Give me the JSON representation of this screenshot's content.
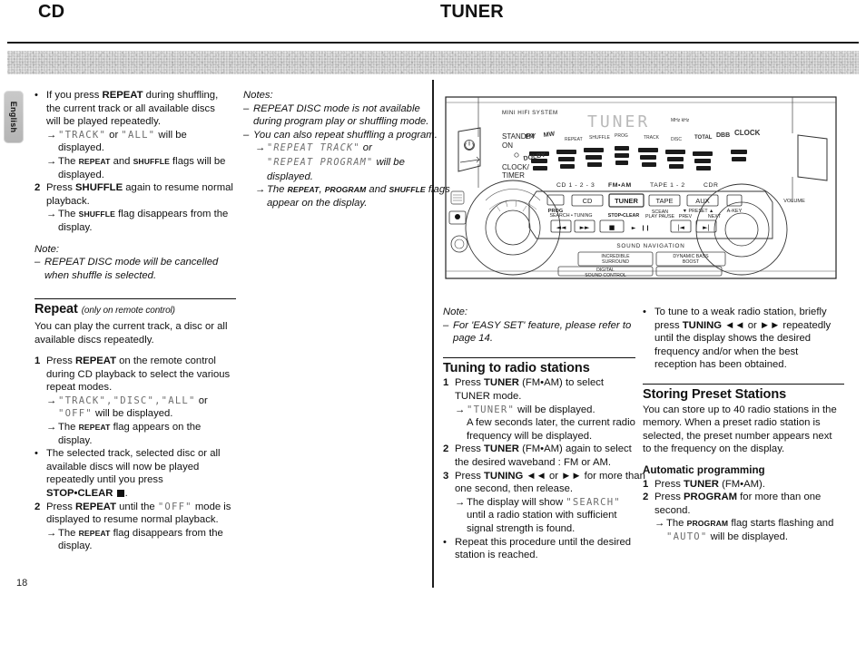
{
  "page": {
    "number": "18",
    "language_tab": "English"
  },
  "headers": {
    "left": "CD",
    "right": "TUNER"
  },
  "cd_column_1": {
    "bullet_repeat": {
      "marker": "•",
      "lines": [
        "If you press REPEAT during shuffling,",
        "the current track or all available discs",
        "will be played repeatedly."
      ],
      "bold_words": [
        "REPEAT"
      ]
    },
    "arrow_1": {
      "marker": "→",
      "lcd_a": "\"TRACK\"",
      "mid": " or ",
      "lcd_b": "\"ALL\"",
      "tail": " will be",
      "line2": "displayed."
    },
    "arrow_2": {
      "marker": "→",
      "pre": "The ",
      "sc_a": "REPEAT",
      "mid": " and ",
      "sc_b": "SHUFFLE",
      "tail": " flags will be",
      "line2": "displayed."
    },
    "step_2": {
      "marker": "2",
      "pre": "Press ",
      "bold": "SHUFFLE",
      "tail": " again to resume normal",
      "line2": "playback."
    },
    "arrow_3": {
      "marker": "→",
      "pre": "The ",
      "sc": "SHUFFLE",
      "tail": " flag disappears from the",
      "line2": "display."
    },
    "note_head": "Note:",
    "note_item": {
      "marker": "–",
      "line1": "REPEAT DISC mode will be cancelled",
      "line2": "when shuffle is selected."
    },
    "repeat_section": {
      "heading": "Repeat",
      "heading_note": "(only on remote control)",
      "intro_l1": "You can play the current track, a disc or all",
      "intro_l2": "available discs repeatedly."
    },
    "step_r1": {
      "marker": "1",
      "pre": "Press ",
      "bold": "REPEAT",
      "tail": " on the remote control",
      "line2": "during CD playback to select the various",
      "line3": "repeat modes."
    },
    "arrow_r1": {
      "marker": "→",
      "lcd_a": "\"TRACK\",",
      "lcd_b": "\"DISC\",",
      "lcd_c": "\"ALL\"",
      "tail": " or",
      "lcd_d": "\"OFF\"",
      "tail2": " will be displayed."
    },
    "arrow_r2": {
      "marker": "→",
      "pre": "The ",
      "sc": "REPEAT",
      "tail": " flag appears on the",
      "line2": "display."
    },
    "bullet_r1": {
      "marker": "•",
      "line1": "The selected track, selected disc or all",
      "line2": "available discs will now be played",
      "line3": "repeatedly until you press",
      "line4_bold": "STOP•CLEAR"
    },
    "step_r2": {
      "marker": "2",
      "pre": "Press ",
      "bold": "REPEAT",
      "mid": " until the ",
      "lcd": "\"OFF\"",
      "tail": " mode is",
      "line2": "displayed to resume normal playback."
    },
    "arrow_r3": {
      "marker": "→",
      "pre": "The ",
      "sc": "REPEAT",
      "tail": " flag disappears from the",
      "line2": "display."
    }
  },
  "cd_column_2": {
    "notes_head": "Notes:",
    "note_1": {
      "marker": "–",
      "line1": "REPEAT DISC mode is not available",
      "line2": "during program play or shuffling mode."
    },
    "note_2": {
      "marker": "–",
      "line1": "You can also repeat shuffling a program."
    },
    "arrow_n1": {
      "marker": "→",
      "lcd_a": "\"REPEAT TRACK\"",
      "tail_a": " or",
      "lcd_b": "\"REPEAT PROGRAM\"",
      "tail_b": " will be",
      "line3": "displayed."
    },
    "arrow_n2": {
      "marker": "→",
      "pre": "The ",
      "sc_a": "REPEAT",
      "mid_a": ", ",
      "sc_b": "PROGRAM",
      "mid_b": " and ",
      "sc_c": "SHUFFLE",
      "tail": " flags",
      "line2": "appear on the display."
    }
  },
  "tuner_column_1": {
    "note_head": "Note:",
    "note_item": {
      "marker": "–",
      "line1": "For 'EASY SET' feature, please refer to",
      "line2": "page 14."
    },
    "heading": "Tuning to radio stations",
    "step_1": {
      "marker": "1",
      "pre": "Press ",
      "bold": "TUNER",
      "paren": " (FM•AM)",
      "tail": " to select",
      "line2": "TUNER mode."
    },
    "arrow_1": {
      "marker": "→",
      "lcd": "\"TUNER\"",
      "tail": " will be displayed.",
      "line2": "A few seconds later, the current radio",
      "line3": "frequency will be displayed."
    },
    "step_2": {
      "marker": "2",
      "pre": "Press ",
      "bold": "TUNER",
      "paren": " (FM•AM)",
      "tail": " again to select",
      "line2": "the desired waveband : FM or AM."
    },
    "step_3": {
      "marker": "3",
      "pre": "Press ",
      "bold": "TUNING",
      "icon_a": "◄◄",
      "mid": " or ",
      "icon_b": "►►",
      "tail": " for more than",
      "line2": "one second, then release."
    },
    "arrow_3": {
      "marker": "→",
      "pre": "The display will show ",
      "lcd": "\"SEARCH\"",
      "line2": "until a radio station with sufficient",
      "line3": "signal strength is found."
    },
    "bullet_1": {
      "marker": "•",
      "line1": "Repeat this procedure until the desired",
      "line2": "station is reached."
    }
  },
  "tuner_column_2": {
    "bullet_1": {
      "marker": "•",
      "pre": "To tune to a weak radio station, briefly",
      "l2_pre": "press ",
      "l2_bold": "TUNING",
      "icon_a": "◄◄",
      "l2_mid": " or ",
      "icon_b": "►►",
      "l2_tail": " repeatedly",
      "line3": "until the display shows the desired",
      "line4": "frequency and/or when the best",
      "line5": "reception has been obtained."
    },
    "heading": "Storing Preset Stations",
    "intro": {
      "line1": "You can store up to 40 radio stations in the",
      "line2": "memory. When a preset radio station is",
      "line3": "selected, the preset number appears next",
      "line4": "to the frequency on the display."
    },
    "sub_heading": "Automatic programming",
    "step_1": {
      "marker": "1",
      "pre": "Press ",
      "bold": "TUNER",
      "paren": " (FM•AM)."
    },
    "step_2": {
      "marker": "2",
      "pre": "Press ",
      "bold": "PROGRAM",
      "tail": " for more than one",
      "line2": "second."
    },
    "arrow_2": {
      "marker": "→",
      "pre": "The ",
      "sc": "PROGRAM",
      "tail": " flag starts flashing and",
      "lcd": "\"AUTO\"",
      "tail2": " will be displayed."
    }
  },
  "diagram": {
    "name": "mini-hifi-front-panel",
    "labels": {
      "system": "MINI HIFI SYSTEM",
      "standby": "STANDBY",
      "on": "ON",
      "clock_timer_l1": "CLOCK/",
      "clock_timer_l2": "TIMER",
      "src_cd": "CD 1 - 2 - 3",
      "src_fm_am": "FM•AM",
      "src_tape": "TAPE 1 - 2",
      "src_cdr": "CDR",
      "btn_cd": "CD",
      "btn_tuner": "TUNER",
      "btn_tape": "TAPE",
      "btn_aux": "AUX",
      "btn_prog": "PROG",
      "search_tuning": "SEARCH • TUNING",
      "stop_clear": "STOP•CLEAR",
      "play_pause_top": "SCEAN",
      "play_pause": "PLAY  PAUSE",
      "prev_next_top": "▼ PRESET ▲",
      "prev": "PREV",
      "next": "NEXT",
      "volume": "VOLUME",
      "a_key": "A-KEY",
      "sound_navigation": "SOUND NAVIGATION",
      "incredible_surround_l1": "INCREDIBLE",
      "incredible_surround_l2": "SURROUND",
      "dynamic_bass_l1": "DYNAMIC BASS",
      "dynamic_bass_l2": "BOOST",
      "digital_sound_l1": "DIGITAL",
      "digital_sound_l2": "SOUND CONTROL",
      "display_text": "TUNER"
    }
  }
}
